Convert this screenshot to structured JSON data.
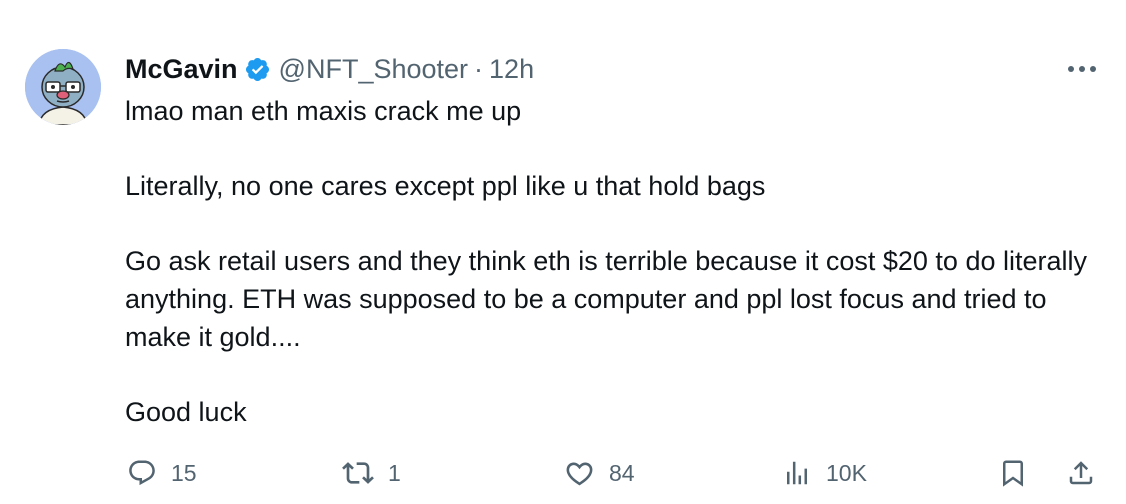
{
  "tweet": {
    "author": {
      "display_name": "McGavin",
      "handle": "@NFT_Shooter",
      "verified": true,
      "avatar_icon": "cartoon-avatar-icon"
    },
    "separator": "·",
    "time": "12h",
    "more_icon": "more-horizontal-icon",
    "paragraphs": [
      "lmao man eth maxis crack me up",
      "Literally, no one cares except ppl like u that hold bags",
      "Go ask retail users and they think eth is terrible because it cost $20 to do literally anything. ETH was supposed to be a computer and ppl lost focus and tried to make it gold....",
      "Good luck"
    ],
    "actions": {
      "reply": {
        "icon": "reply-icon",
        "count": "15"
      },
      "repost": {
        "icon": "repost-icon",
        "count": "1"
      },
      "like": {
        "icon": "heart-icon",
        "count": "84"
      },
      "views": {
        "icon": "views-icon",
        "count": "10K"
      },
      "bookmark": {
        "icon": "bookmark-icon"
      },
      "share": {
        "icon": "share-icon"
      }
    }
  },
  "colors": {
    "text": "#0f1419",
    "secondary": "#536471",
    "verified": "#1d9bf0",
    "background": "#ffffff"
  }
}
